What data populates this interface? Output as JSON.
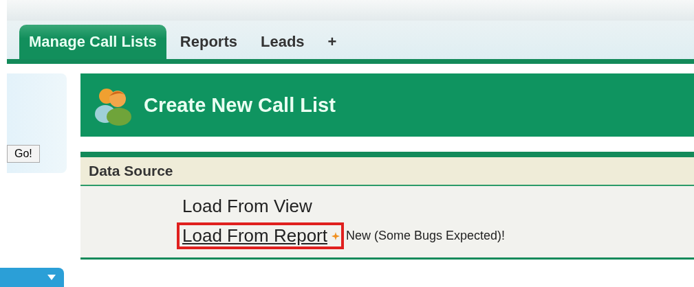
{
  "tabs": [
    {
      "label": "Manage Call Lists",
      "selected": true
    },
    {
      "label": "Reports",
      "selected": false
    },
    {
      "label": "Leads",
      "selected": false
    },
    {
      "label": "+",
      "selected": false
    }
  ],
  "sidebar": {
    "go_button": "Go!"
  },
  "header": {
    "title": "Create New Call List"
  },
  "section": {
    "title": "Data Source",
    "links": [
      {
        "label": "Load From View",
        "hovered": false,
        "highlighted": false
      },
      {
        "label": "Load From Report",
        "hovered": true,
        "highlighted": true,
        "note": "New (Some Bugs Expected)!"
      }
    ]
  }
}
